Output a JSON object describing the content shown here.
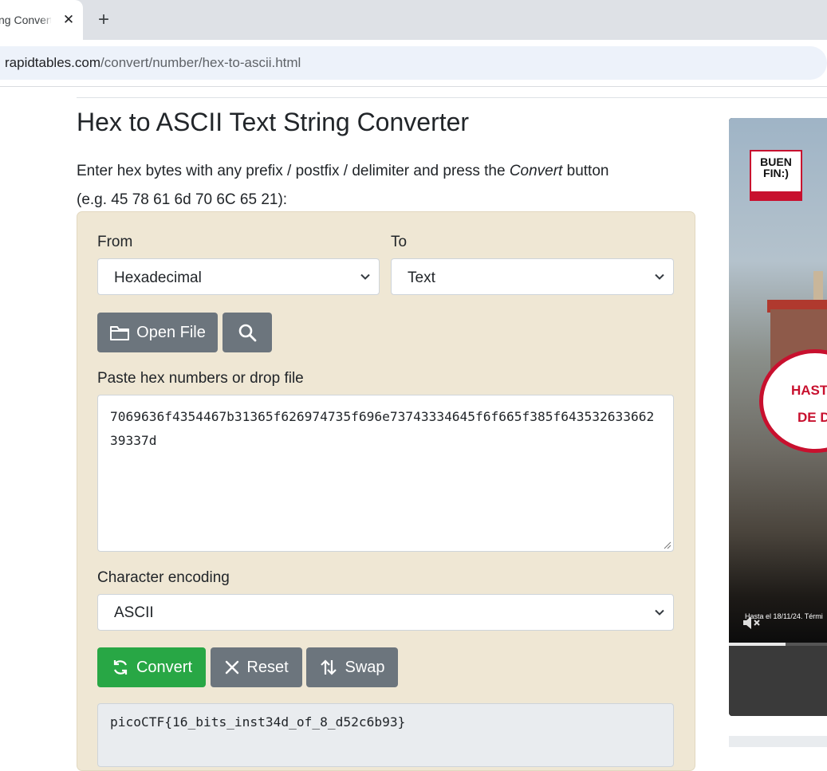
{
  "browser": {
    "tab_title": "ng Convert",
    "close_glyph": "✕",
    "newtab_glyph": "+",
    "url_host": "rapidtables.com",
    "url_path": "/convert/number/hex-to-ascii.html"
  },
  "page": {
    "title": "Hex to ASCII Text String Converter",
    "instruction_pre": "Enter hex bytes with any prefix / postfix / delimiter and press the ",
    "instruction_em": "Convert",
    "instruction_post": " button",
    "example": "(e.g. 45 78 61 6d 70 6C 65 21):"
  },
  "form": {
    "from_label": "From",
    "from_value": "Hexadecimal",
    "to_label": "To",
    "to_value": "Text",
    "open_file_label": "Open File",
    "input_label": "Paste hex numbers or drop file",
    "input_value": "7069636f4354467b31365f626974735f696e73743334645f6f665f385f64353263366239337d",
    "encoding_label": "Character encoding",
    "encoding_value": "ASCII",
    "convert_label": "Convert",
    "reset_label": "Reset",
    "swap_label": "Swap",
    "output_value": "picoCTF{16_bits_inst34d_of_8_d52c6b93}"
  },
  "ad": {
    "logo_line1": "BUEN",
    "logo_line2": "FIN:)",
    "sign_line1": "HAST",
    "sign_line2": "DE D",
    "legal": "Hasta el 18/11/24. Térmi",
    "progress": 0.58
  },
  "colors": {
    "panel_bg": "#efe7d4",
    "btn_gray": "#6c757d",
    "btn_green": "#28a745",
    "output_bg": "#e9ecef"
  },
  "icons": [
    "close-icon",
    "plus-icon",
    "folder-icon",
    "search-icon",
    "chevron-down-icon",
    "refresh-icon",
    "x-icon",
    "swap-icon",
    "mute-icon",
    "resize-grip-icon"
  ]
}
